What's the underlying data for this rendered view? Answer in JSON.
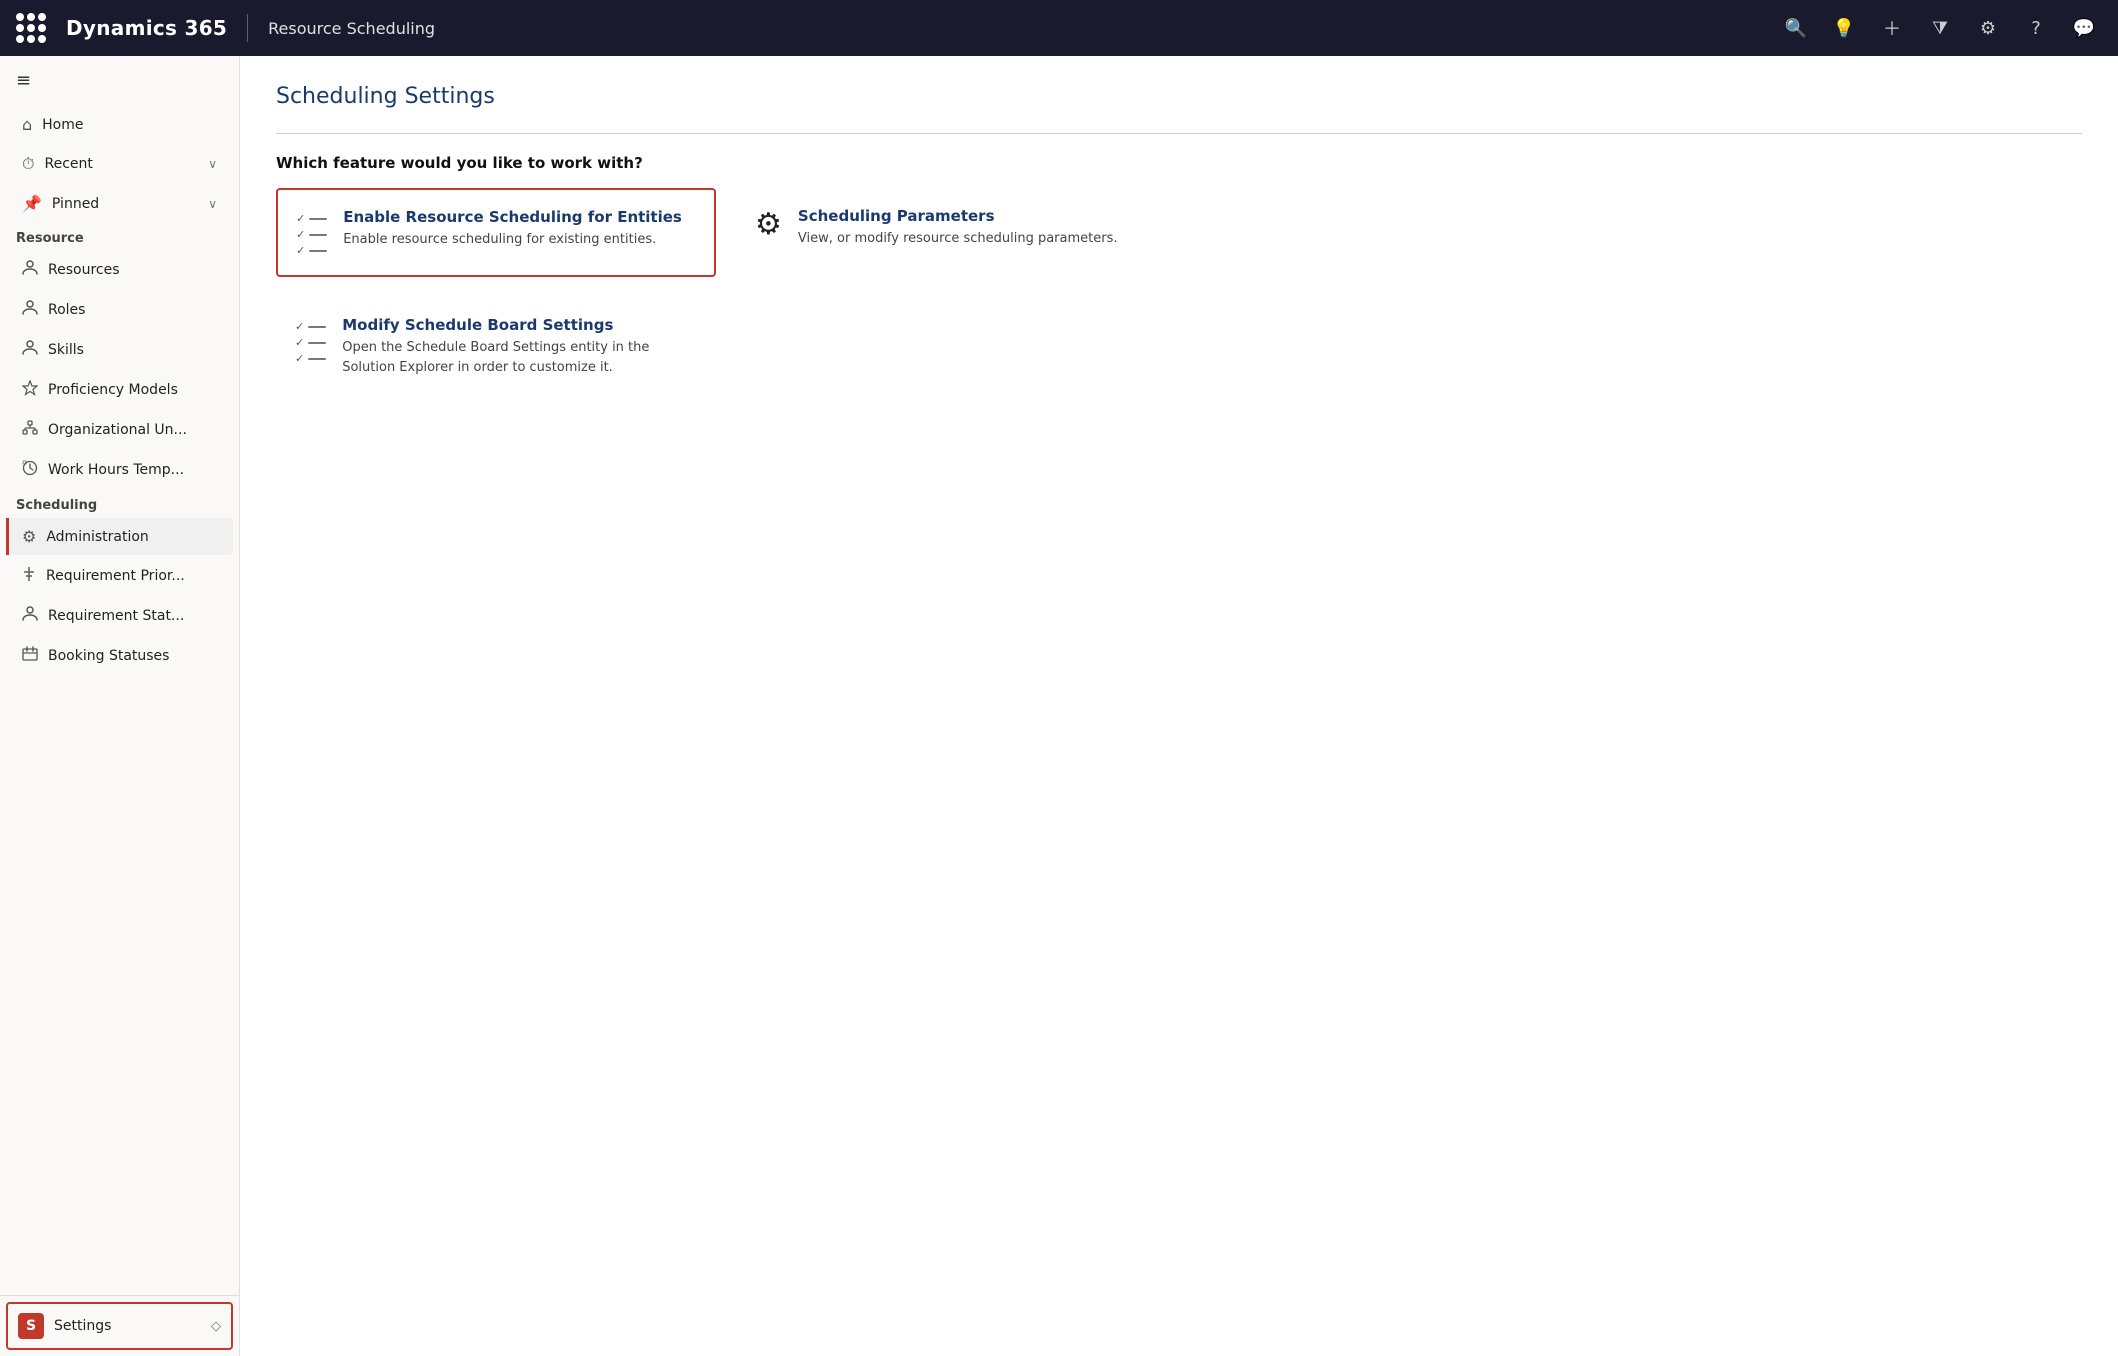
{
  "topnav": {
    "brand": "Dynamics 365",
    "module": "Resource Scheduling",
    "icons": [
      "search",
      "lightbulb",
      "plus",
      "filter",
      "settings",
      "help",
      "chat"
    ]
  },
  "sidebar": {
    "hamburger_label": "≡",
    "sections": [
      {
        "label": "",
        "items": [
          {
            "id": "home",
            "icon": "🏠",
            "label": "Home",
            "has_chevron": false
          },
          {
            "id": "recent",
            "icon": "🕐",
            "label": "Recent",
            "has_chevron": true
          },
          {
            "id": "pinned",
            "icon": "📌",
            "label": "Pinned",
            "has_chevron": true
          }
        ]
      },
      {
        "label": "Resource",
        "items": [
          {
            "id": "resources",
            "icon": "👤",
            "label": "Resources",
            "has_chevron": false
          },
          {
            "id": "roles",
            "icon": "👤",
            "label": "Roles",
            "has_chevron": false
          },
          {
            "id": "skills",
            "icon": "👤",
            "label": "Skills",
            "has_chevron": false
          },
          {
            "id": "proficiency",
            "icon": "⭐",
            "label": "Proficiency Models",
            "has_chevron": false
          },
          {
            "id": "orgunit",
            "icon": "🏢",
            "label": "Organizational Un...",
            "has_chevron": false
          },
          {
            "id": "workhours",
            "icon": "⏰",
            "label": "Work Hours Temp...",
            "has_chevron": false
          }
        ]
      },
      {
        "label": "Scheduling",
        "items": [
          {
            "id": "administration",
            "icon": "⚙",
            "label": "Administration",
            "has_chevron": false,
            "active": true
          },
          {
            "id": "requirement-priority",
            "icon": "↕",
            "label": "Requirement Prior...",
            "has_chevron": false
          },
          {
            "id": "requirement-status",
            "icon": "👤",
            "label": "Requirement Stat...",
            "has_chevron": false
          },
          {
            "id": "booking-statuses",
            "icon": "🚩",
            "label": "Booking Statuses",
            "has_chevron": false
          }
        ]
      }
    ],
    "bottom": {
      "badge": "S",
      "label": "Settings",
      "has_chevron": true
    }
  },
  "content": {
    "page_title": "Scheduling Settings",
    "which_feature_label": "Which feature would you like to work with?",
    "cards": [
      {
        "id": "enable-resource-scheduling",
        "icon_type": "checklist",
        "title": "Enable Resource Scheduling for Entities",
        "description": "Enable resource scheduling for existing entities.",
        "highlighted": true
      },
      {
        "id": "scheduling-parameters",
        "icon_type": "gear",
        "title": "Scheduling Parameters",
        "description": "View, or modify resource scheduling parameters.",
        "highlighted": false
      },
      {
        "id": "modify-schedule-board",
        "icon_type": "checklist",
        "title": "Modify Schedule Board Settings",
        "description": "Open the Schedule Board Settings entity in the Solution Explorer in order to customize it.",
        "highlighted": false
      }
    ]
  }
}
